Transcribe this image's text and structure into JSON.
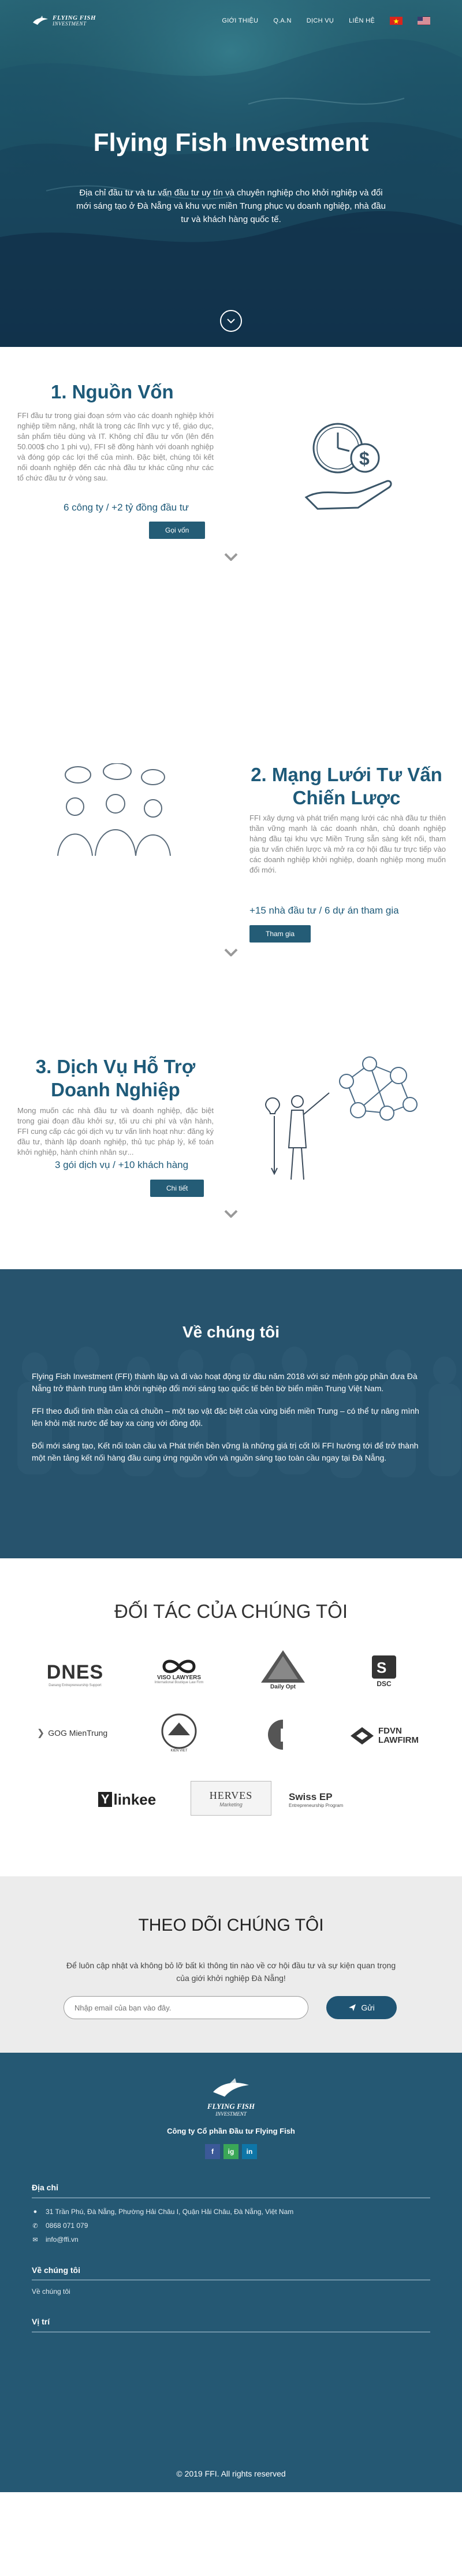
{
  "header": {
    "logo_line1": "FLYING FISH",
    "logo_line2": "INVESTMENT",
    "nav": [
      "GIỚI THIỆU",
      "Q.A.N",
      "DỊCH VỤ",
      "LIÊN HỆ"
    ]
  },
  "hero": {
    "title": "Flying Fish Investment",
    "subtitle": "Địa chỉ đầu tư và tư vấn đầu tư uy tín và chuyên nghiệp cho khởi nghiệp và đổi mới sáng tạo ở Đà Nẵng và khu vực miền Trung phục vụ doanh nghiệp, nhà đầu tư và khách hàng quốc tế."
  },
  "features": [
    {
      "title": "1. Nguồn Vốn",
      "text": "FFI đầu tư trong giai đoạn sớm vào các doanh nghiệp khởi nghiệp tiềm năng, nhất là trong các lĩnh vực y tế, giáo dục, sản phẩm tiêu dùng và IT. Không chỉ đầu tư vốn (lên đến 50.000$ cho 1 phi vụ), FFI sẽ đồng hành với doanh nghiệp và đóng góp các lợi thế của mình. Đặc biệt, chúng tôi kết nối doanh nghiệp đến các nhà đầu tư khác cũng như các tổ chức đầu tư ở vòng sau.",
      "stat": "6 công ty / +2 tỷ đồng đầu tư",
      "button": "Gọi vốn"
    },
    {
      "title": "2. Mạng Lưới Tư Vấn Chiến Lược",
      "text": "FFI xây dựng và phát triển mạng lưới các nhà đầu tư thiên thần vững mạnh là các doanh nhân, chủ doanh nghiệp hàng đầu tại khu vực Miền Trung sẵn sàng kết nối, tham gia tư vấn chiến lược và mở ra cơ hội đầu tư trực tiếp vào các doanh nghiệp khởi nghiệp, doanh nghiệp mong muốn đổi mới.",
      "stat": "+15 nhà đầu tư / 6 dự án tham gia",
      "button": "Tham gia"
    },
    {
      "title": "3. Dịch Vụ Hỗ Trợ Doanh Nghiệp",
      "text": "Mong muốn các nhà đầu tư và doanh nghiệp, đặc biệt trong giai đoạn đầu khởi sự, tối ưu chi phí và vận hành, FFI cung cấp các gói dịch vụ tư vấn linh hoạt như: đăng ký đầu tư, thành lập doanh nghiệp, thủ tục pháp lý, kế toán khởi nghiệp, hành chính nhân sự...",
      "stat": "3 gói dịch vụ / +10 khách hàng",
      "button": "Chi tiết"
    }
  ],
  "about": {
    "title": "Về chúng tôi",
    "p1": "Flying Fish Investment (FFI) thành lập và đi vào hoạt động từ đầu năm 2018 với sứ mệnh góp phần đưa Đà Nẵng trở thành trung tâm khởi nghiệp đổi mới sáng tạo quốc tế bên bờ biển miền Trung Việt Nam.",
    "p2": "FFI theo đuổi tinh thần của cá chuồn – một tạo vật đặc biệt của vùng biển miền Trung – có thể tự nâng mình lên khỏi mặt nước để bay xa cùng với đồng đội.",
    "p3": "Đổi mới sáng tạo, Kết nối toàn cầu và Phát triển bền vững là những giá trị cốt lõi FFI hướng tới để trở thành một nền tảng kết nối hàng đầu cung ứng nguồn vốn và nguồn sáng tạo toàn cầu ngay tại Đà Nẵng."
  },
  "partners": {
    "title": "ĐỐI TÁC CỦA CHÚNG TÔI",
    "logos": [
      {
        "name": "DNES",
        "sub": "Danang Entrepreneurship Support"
      },
      {
        "name": "VISO LAWYERS",
        "sub": "International Boutique Law Firm"
      },
      {
        "name": "Daily Opt",
        "sub": ""
      },
      {
        "name": "DSC",
        "sub": ""
      },
      {
        "name": "GOG MienTrung",
        "sub": ""
      },
      {
        "name": "KIEN VIET",
        "sub": ""
      },
      {
        "name": "E",
        "sub": ""
      },
      {
        "name": "FDVN LAWFIRM",
        "sub": ""
      },
      {
        "name": "linkee",
        "sub": ""
      },
      {
        "name": "HERVES",
        "sub": "Marketing"
      },
      {
        "name": "Swiss EP",
        "sub": "Entrepreneurship Program"
      }
    ]
  },
  "subscribe": {
    "title": "THEO DÕI CHÚNG TÔI",
    "text": "Để luôn cập nhật và không bỏ lỡ bất kì thông tin nào về cơ hội đầu tư và sự kiện quan trọng của giới khởi nghiệp Đà Nẵng!",
    "placeholder": "Nhập email của bạn vào đây.",
    "button": "Gửi"
  },
  "footer": {
    "logo_line1": "FLYING FISH",
    "logo_line2": "INVESTMENT",
    "company": "Công ty Cổ phần Đầu tư Flying Fish",
    "social": [
      "f",
      "ig",
      "in"
    ],
    "address_heading": "Địa chỉ",
    "address": "31 Trần Phú, Đà Nẵng, Phường Hải Châu I, Quận Hải Châu, Đà Nẵng, Việt Nam",
    "phone": "0868 071 079",
    "email": "info@ffi.vn",
    "about_heading": "Về chúng tôi",
    "about_link": "Về chúng tôi",
    "position_heading": "Vị trí",
    "copyright": "© 2019 FFI. All rights reserved"
  },
  "colors": {
    "primary": "#1e5a79",
    "footer_bg": "#255873",
    "button": "#245c76"
  }
}
